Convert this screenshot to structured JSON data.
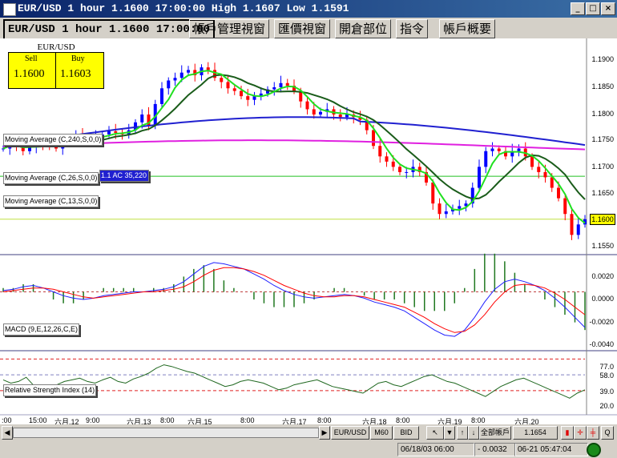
{
  "window": {
    "title": "EUR/USD 1 hour 1.1600 17:00:00 High 1.1607 Low 1.1591",
    "min_icon": "_",
    "max_icon": "□",
    "close_icon": "×"
  },
  "tabs": [
    {
      "label": "EUR/USD 1 hour 1.1600 17:00:00"
    },
    {
      "label": "帳戶管理視窗"
    },
    {
      "label": "匯價視窗"
    },
    {
      "label": "開倉部位"
    },
    {
      "label": "指令"
    },
    {
      "label": "帳戶概要"
    }
  ],
  "pricebox": {
    "title": "EUR/USD",
    "sell_label": "Sell",
    "buy_label": "Buy",
    "sell_value": "1.1600",
    "buy_value": "1.1603"
  },
  "legends": {
    "ma240": "Moving Average (C,240,S,0,0)",
    "ma26": "Moving Average (C,26,S,0,0)",
    "ma26_marker": "1.1 AC 35,220",
    "ma13": "Moving Average (C,13,S,0,0)",
    "macd": "MACD (9,E,12,26,C,E)",
    "rsi": "Relative Strength Index (14)"
  },
  "price_axis": [
    "1.1900",
    "1.1850",
    "1.1800",
    "1.1750",
    "1.1700",
    "1.1650",
    "1.1600",
    "1.1550"
  ],
  "current_price": "1.1600",
  "macd_axis": [
    "0.0020",
    "0.0000",
    "-0.0020",
    "-0.0040"
  ],
  "rsi_axis": [
    "77.0",
    "58.0",
    "39.0",
    "20.0"
  ],
  "time_axis": [
    ":00",
    "15:00",
    "六月.12",
    "9:00",
    "六月.13",
    "8:00",
    "六月.15",
    "8:00",
    "六月.17",
    "8:00",
    "六月.18",
    "8:00",
    "六月.19",
    "8:00",
    "六月.20"
  ],
  "bottom_toolbar": {
    "symbol": "EUR/USD",
    "period": "M60",
    "side": "BID",
    "account": "全部帳戶",
    "rate": "1.1654",
    "zoom_icon": "Q"
  },
  "status": {
    "datetime": "06/18/03 06:00",
    "change": "- 0.0032",
    "clock": "06-21 05:47:04"
  },
  "colors": {
    "ma240": "#2020d0",
    "ma26": "#1a5c1a",
    "ma13": "#20e020",
    "ma_magenta": "#e020e0",
    "up": "#0000ff",
    "down": "#ff0000",
    "macd_hist": "#207820",
    "rsi_line": "#206820",
    "signal": "#ff0000"
  },
  "chart_data": [
    {
      "type": "candlestick",
      "title": "EUR/USD 1 hour",
      "ylim": [
        1.154,
        1.193
      ],
      "y_ticks": [
        1.19,
        1.185,
        1.18,
        1.175,
        1.17,
        1.165,
        1.16,
        1.155
      ],
      "series": [
        {
          "name": "Moving Average (C,240,S,0,0)"
        },
        {
          "name": "Moving Average (C,26,S,0,0)"
        },
        {
          "name": "Moving Average (C,13,S,0,0)"
        }
      ],
      "close_path": [
        1.1735,
        1.1745,
        1.174,
        1.173,
        1.1738,
        1.1745,
        1.1742,
        1.174,
        1.1735,
        1.1748,
        1.1752,
        1.176,
        1.1755,
        1.1752,
        1.1758,
        1.1762,
        1.1768,
        1.1765,
        1.1762,
        1.177,
        1.1785,
        1.18,
        1.178,
        1.182,
        1.185,
        1.1865,
        1.187,
        1.188,
        1.1885,
        1.1875,
        1.189,
        1.1885,
        1.187,
        1.1862,
        1.185,
        1.1845,
        1.1835,
        1.1828,
        1.1835,
        1.184,
        1.1848,
        1.1852,
        1.186,
        1.1855,
        1.1845,
        1.1825,
        1.181,
        1.18,
        1.1805,
        1.181,
        1.18,
        1.1795,
        1.18,
        1.1795,
        1.179,
        1.177,
        1.174,
        1.172,
        1.171,
        1.17,
        1.169,
        1.169,
        1.17,
        1.169,
        1.167,
        1.163,
        1.161,
        1.1615,
        1.162,
        1.1625,
        1.163,
        1.166,
        1.17,
        1.173,
        1.1735,
        1.173,
        1.172,
        1.173,
        1.1735,
        1.172,
        1.17,
        1.169,
        1.168,
        1.166,
        1.164,
        1.161,
        1.157,
        1.159,
        1.16
      ]
    },
    {
      "type": "line",
      "title": "MACD (9,E,12,26,C,E)",
      "ylim": [
        -0.0045,
        0.0028
      ],
      "y_ticks": [
        0.002,
        0.0,
        -0.002,
        -0.004
      ],
      "series": [
        {
          "values": [
            0.0001,
            0.0002,
            0.0004,
            0.0005,
            0.0003,
            0.0,
            -0.0003,
            -0.0005,
            -0.0006,
            -0.0005,
            -0.0003,
            -0.0002,
            -0.0001,
            0.0,
            0.0,
            0.0001,
            0.0002,
            0.0004,
            0.0008,
            0.0014,
            0.002,
            0.0023,
            0.0022,
            0.002,
            0.0018,
            0.0014,
            0.001,
            0.0005,
            0.0001,
            -0.0002,
            -0.0004,
            -0.0005,
            -0.0004,
            -0.0003,
            -0.0002,
            -0.0003,
            -0.0005,
            -0.0008,
            -0.001,
            -0.0012,
            -0.0015,
            -0.002,
            -0.0025,
            -0.003,
            -0.0034,
            -0.0035,
            -0.003,
            -0.002,
            -0.0008,
            0.0002,
            0.0008,
            0.001,
            0.0008,
            0.0005,
            0.0001,
            -0.0005,
            -0.0012,
            -0.002,
            -0.0028
          ]
        },
        {
          "values": [
            0.0,
            0.0001,
            0.0002,
            0.0003,
            0.0003,
            0.0002,
            0.0,
            -0.0002,
            -0.0004,
            -0.0005,
            -0.0004,
            -0.0003,
            -0.0002,
            -0.0001,
            0.0,
            0.0,
            0.0001,
            0.0002,
            0.0004,
            0.0008,
            0.0013,
            0.0017,
            0.0019,
            0.0019,
            0.0018,
            0.0016,
            0.0013,
            0.0009,
            0.0005,
            0.0002,
            -0.0001,
            -0.0003,
            -0.0004,
            -0.0004,
            -0.0003,
            -0.0003,
            -0.0004,
            -0.0006,
            -0.0008,
            -0.001,
            -0.0012,
            -0.0016,
            -0.002,
            -0.0025,
            -0.0029,
            -0.0032,
            -0.0031,
            -0.0026,
            -0.0018,
            -0.0008,
            0.0,
            0.0005,
            0.0006,
            0.0005,
            0.0003,
            -0.0001,
            -0.0006,
            -0.0012,
            -0.0018
          ]
        }
      ]
    },
    {
      "type": "line",
      "title": "Relative Strength Index (14)",
      "ylim": [
        12,
        85
      ],
      "y_ticks": [
        77,
        58,
        39,
        20
      ],
      "series": [
        {
          "values": [
            52,
            48,
            50,
            55,
            45,
            42,
            40,
            46,
            50,
            52,
            54,
            50,
            48,
            52,
            55,
            50,
            48,
            53,
            56,
            60,
            66,
            70,
            68,
            65,
            62,
            60,
            56,
            52,
            48,
            44,
            46,
            50,
            52,
            50,
            48,
            44,
            40,
            42,
            46,
            48,
            50,
            52,
            48,
            44,
            42,
            40,
            38,
            36,
            42,
            48,
            50,
            46,
            44,
            48,
            52,
            56,
            58,
            54,
            50,
            48,
            44,
            40,
            36,
            32,
            38,
            44,
            48,
            52,
            54,
            50,
            46,
            42,
            38,
            34,
            30,
            36,
            40
          ]
        }
      ]
    }
  ]
}
